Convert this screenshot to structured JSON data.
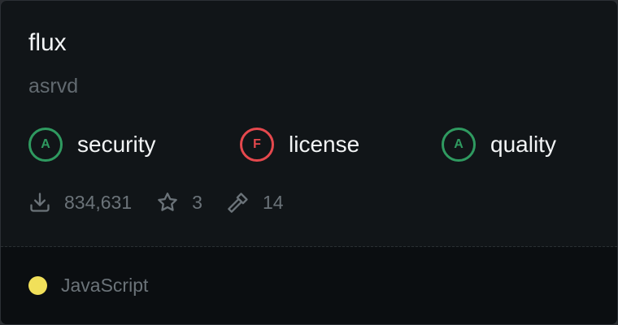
{
  "package": {
    "name": "flux",
    "owner": "asrvd"
  },
  "grades": [
    {
      "grade": "A",
      "label": "security",
      "status": "pass",
      "color": "#2f9a60"
    },
    {
      "grade": "F",
      "label": "license",
      "status": "fail",
      "color": "#e5484d"
    },
    {
      "grade": "A",
      "label": "quality",
      "status": "pass",
      "color": "#2f9a60"
    }
  ],
  "stats": {
    "downloads": "834,631",
    "stars": "3",
    "dependents": "14"
  },
  "icons": {
    "downloads": "download-icon",
    "stars": "star-icon",
    "dependents": "hammer-icon"
  },
  "language": {
    "name": "JavaScript",
    "color": "#f1e05a"
  }
}
